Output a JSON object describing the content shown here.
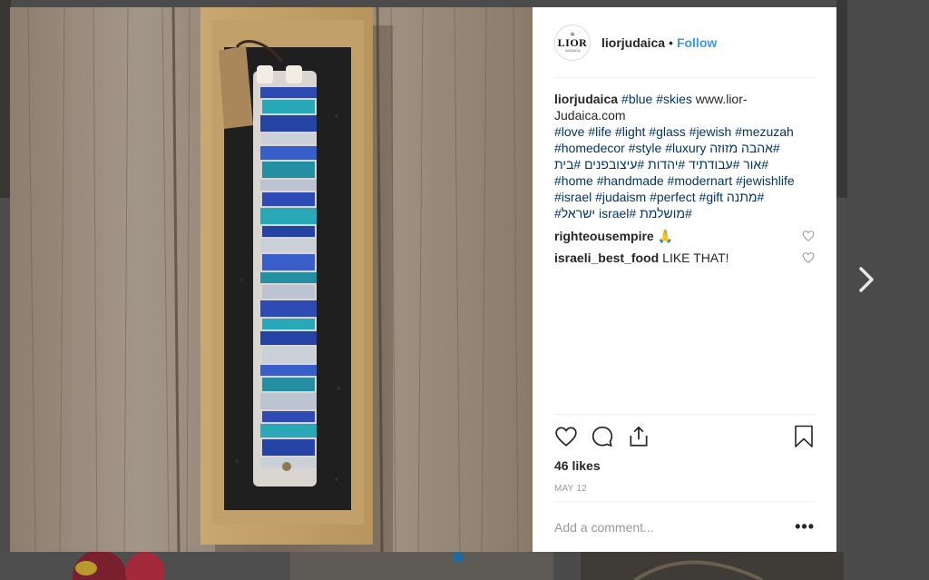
{
  "post": {
    "avatar_logo": {
      "top": "✡",
      "main": "LIOR",
      "sub": "JUDAICA"
    },
    "username": "liorjudaica",
    "separator": "•",
    "follow_label": "Follow",
    "caption": {
      "username": "liorjudaica",
      "line1": [
        "#blue",
        "#skies"
      ],
      "line1_text": "www.lior-Judaica.com",
      "line2": [
        "#love",
        "#life",
        "#light",
        "#glass",
        "#jewish",
        "#mezuzah"
      ],
      "line3_ltr": [
        "#homedecor",
        "#style",
        "#luxury"
      ],
      "line3_rtl": [
        "#אהבה",
        "מזוזה"
      ],
      "line4_rtl": [
        "#אור",
        "#עבודתיד",
        "#יהדות",
        "#עיצובפנים",
        "#בית"
      ],
      "line5": [
        "#home",
        "#handmade",
        "#modernart",
        "#jewishlife"
      ],
      "line6_ltr": [
        "#israel",
        "#judaism",
        "#perfect",
        "#gift"
      ],
      "line6_rtl": [
        "#מתנה"
      ],
      "line7_rtl": [
        "#מושלמת",
        "#israel",
        "ישראל#"
      ]
    },
    "comments": [
      {
        "username": "righteousempire",
        "text": "🙏"
      },
      {
        "username": "israeli_best_food",
        "text": "LIKE THAT!"
      }
    ],
    "likes_text": "46 likes",
    "date": "MAY 12",
    "add_comment_placeholder": "Add a comment...",
    "more_label": "•••"
  },
  "icons": {
    "like": "heart-icon",
    "comment": "comment-bubble-icon",
    "share": "share-icon",
    "save": "bookmark-icon",
    "next": "chevron-right-icon"
  },
  "colors": {
    "link": "#003569",
    "follow": "#3897f0",
    "text": "#262626",
    "muted": "#999999"
  }
}
